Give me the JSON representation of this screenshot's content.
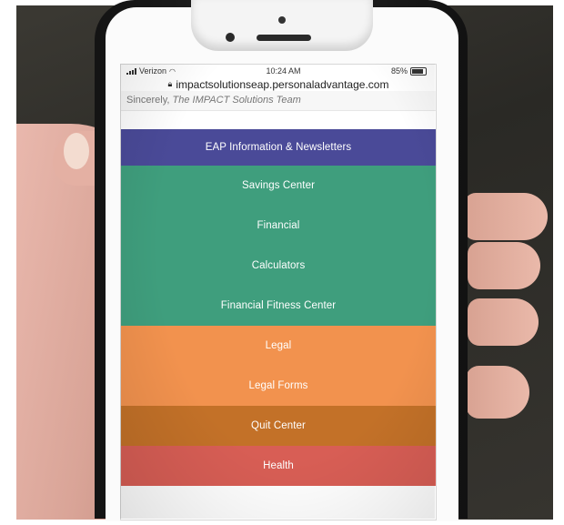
{
  "status_bar": {
    "carrier": "Verizon",
    "time": "10:24 AM",
    "battery": "85%",
    "battery_level": 0.85,
    "wifi_icon": "wifi-icon",
    "signal_icon": "signal-icon",
    "battery_icon": "battery-icon"
  },
  "browser": {
    "url": "impactsolutionseap.personaladvantage.com",
    "lock_icon": "lock-icon"
  },
  "page": {
    "signature_prefix": "Sincerely,",
    "signature_team": "The IMPACT Solutions Team"
  },
  "menu": {
    "items": [
      {
        "label": "EAP Information & Newsletters",
        "color": "#4a4a98"
      },
      {
        "label": "Savings Center",
        "color": "#3f9e7d"
      },
      {
        "label": "Financial",
        "color": "#3f9e7d"
      },
      {
        "label": "Calculators",
        "color": "#3f9e7d"
      },
      {
        "label": "Financial Fitness Center",
        "color": "#3f9e7d"
      },
      {
        "label": "Legal",
        "color": "#f2924e"
      },
      {
        "label": "Legal Forms",
        "color": "#f2924e"
      },
      {
        "label": "Quit Center",
        "color": "#c37128"
      },
      {
        "label": "Health",
        "color": "#d85e55"
      }
    ]
  }
}
